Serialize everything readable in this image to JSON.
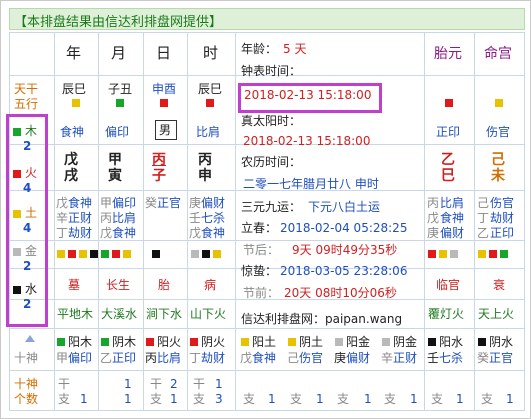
{
  "header": "【本排盘结果由信达利排盘网提供】",
  "cols": {
    "year": "年",
    "month": "月",
    "day": "日",
    "hour": "时"
  },
  "left_labels": {
    "tiangan": "天干",
    "wuxing": "五行",
    "shishen": "十神",
    "geshu": "个数"
  },
  "cang_gan": {
    "year": "辰巳",
    "month": "子丑",
    "day": "申酉",
    "hour": "辰巳"
  },
  "shishen_top": {
    "year": "食神",
    "month": "偏印",
    "day": "男",
    "hour": "比肩"
  },
  "pillars": {
    "year": [
      "戊",
      "戌"
    ],
    "month": [
      "甲",
      "寅"
    ],
    "day": [
      "丙",
      "子"
    ],
    "hour": [
      "丙",
      "申"
    ]
  },
  "hidden": {
    "year": [
      [
        "戊",
        "食神"
      ],
      [
        "辛",
        "正财"
      ],
      [
        "丁",
        "劫财"
      ]
    ],
    "month": [
      [
        "甲",
        "偏印"
      ],
      [
        "丙",
        "比肩"
      ],
      [
        "戊",
        "食神"
      ]
    ],
    "day": [
      [
        "癸",
        "正官"
      ]
    ],
    "hour": [
      [
        "庚",
        "偏财"
      ],
      [
        "壬",
        "七杀"
      ],
      [
        "戊",
        "食神"
      ]
    ]
  },
  "stage": {
    "year": "墓",
    "month": "长生",
    "day": "胎",
    "hour": "病"
  },
  "nayin": {
    "year": "平地木",
    "month": "大溪水",
    "day": "涧下水",
    "hour": "山下火"
  },
  "bottom_cols": {
    "year": [
      "阳木",
      "甲",
      "偏印"
    ],
    "month": [
      "阴木",
      "乙",
      "正印"
    ],
    "day": [
      "阳火",
      "丙",
      "比肩"
    ],
    "hour": [
      "阴火",
      "丁",
      "劫财"
    ]
  },
  "counts": {
    "year": {
      "gan": "",
      "zhi": "1"
    },
    "month": {
      "gan": "1",
      "zhi": "1"
    },
    "day": {
      "gan": "2",
      "zhi": "1"
    },
    "hour": {
      "gan": "1",
      "zhi": "3"
    }
  },
  "wuxing_counts": [
    {
      "name": "木",
      "count": "2",
      "color": "#16a62a"
    },
    {
      "name": "火",
      "count": "4",
      "color": "#e01a1a"
    },
    {
      "name": "土",
      "count": "4",
      "color": "#e6c200"
    },
    {
      "name": "金",
      "count": "2",
      "color": "#b9b9b9"
    },
    {
      "name": "水",
      "count": "2",
      "color": "#111111"
    }
  ],
  "info": {
    "age_label": "年龄：",
    "age_value": "5 天",
    "clock_label": "钟表时间：",
    "clock_value": "2018-02-13 15:18:00",
    "solar_label": "真太阳时：",
    "solar_value": "2018-02-13 15:18:00",
    "lunar_label": "农历时间：",
    "lunar_value": "二零一七年腊月廿八 申时",
    "sanyuan_label": "三元九运：",
    "sanyuan_value": "下元八白土运",
    "lichun_label": "立春：",
    "lichun_value": "2018-02-04 05:28:25",
    "jieqian_label": "节后：",
    "jieqian_value": "9天 09时49分35秒",
    "jingzhe_label": "惊蛰：",
    "jingzhe_value": "2018-03-05 23:28:06",
    "jiehou_label": "节前：",
    "jiehou_value": "20天 08时10分06秒",
    "site": "信达利排盘网：paipan.wang"
  },
  "right_cols": {
    "taiyuan": "胎元",
    "minggong": "命宫"
  },
  "right_shishen": {
    "taiyuan": "正印",
    "minggong": "伤官"
  },
  "right_pillars": {
    "taiyuan": [
      "乙",
      "巳"
    ],
    "minggong": [
      "己",
      "未"
    ]
  },
  "right_hidden": {
    "taiyuan": [
      [
        "丙",
        "比肩"
      ],
      [
        "戊",
        "食神"
      ],
      [
        "庚",
        "偏财"
      ]
    ],
    "minggong": [
      [
        "己",
        "伤官"
      ],
      [
        "丁",
        "劫财"
      ],
      [
        "乙",
        "正印"
      ]
    ]
  },
  "right_stage": {
    "taiyuan": "临官",
    "minggong": "衰"
  },
  "right_nayin": {
    "taiyuan": "覆灯火",
    "minggong": "天上火"
  },
  "right_bottom": {
    "a": [
      "阳土",
      "戊",
      "食神"
    ],
    "b": [
      "阴土",
      "己",
      "伤官"
    ],
    "c": [
      "阳金",
      "庚",
      "偏财"
    ],
    "d": [
      "阴金",
      "辛",
      "正财"
    ],
    "e": [
      "阳水",
      "壬",
      "七杀"
    ],
    "f": [
      "阴水",
      "癸",
      "正官"
    ]
  },
  "right_counts": {
    "a": "1",
    "b": "1",
    "c": "1",
    "d": "1",
    "e": "1",
    "f": "1"
  },
  "bottom_labels": {
    "shishen": "十神",
    "gan": "干",
    "zhi": "支"
  }
}
